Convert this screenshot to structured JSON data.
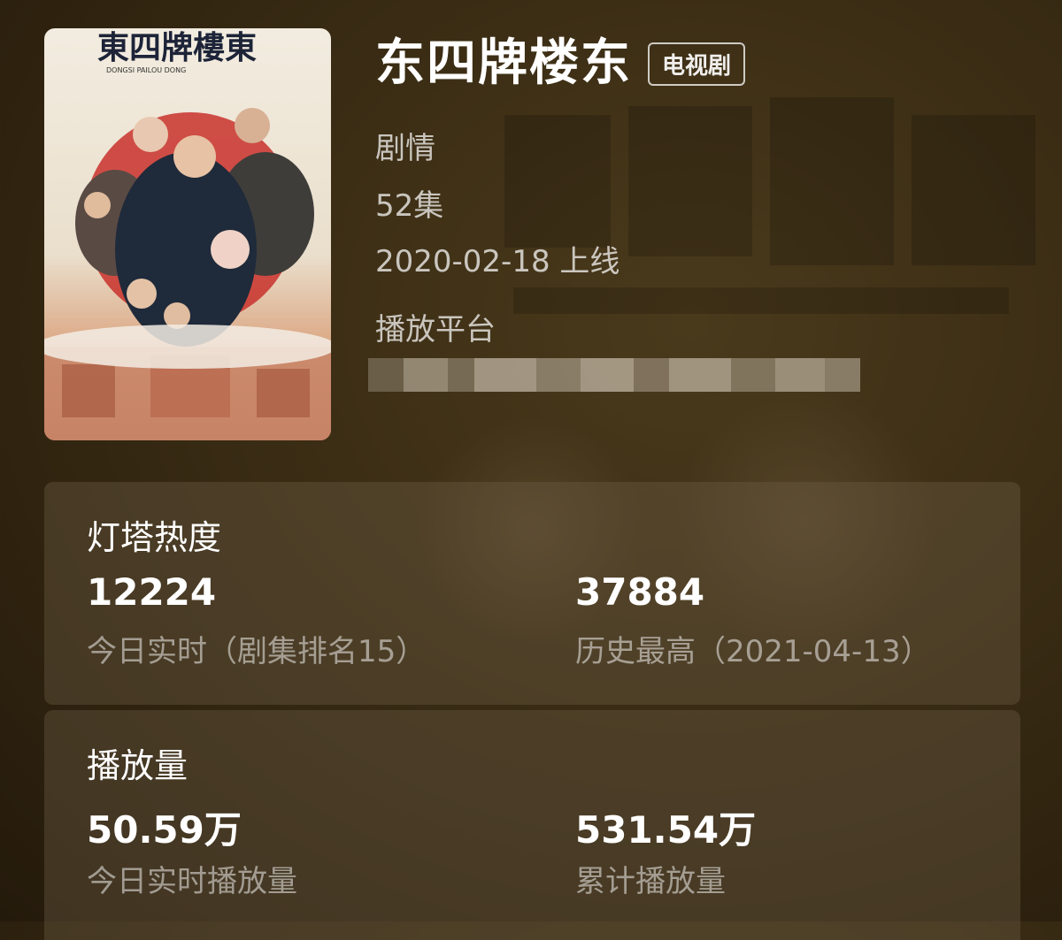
{
  "show": {
    "title": "东四牌楼东",
    "type_badge": "电视剧",
    "genre": "剧情",
    "episodes": "52集",
    "release": "2020-02-18 上线",
    "platform_label": "播放平台"
  },
  "poster": {
    "title_text": "東四牌樓東",
    "subtitle_text": "DONGSI PAILOU DONG"
  },
  "heat": {
    "title": "灯塔热度",
    "today_value": "12224",
    "today_label": "今日实时（剧集排名15）",
    "peak_value": "37884",
    "peak_label": "历史最高（2021-04-13）"
  },
  "plays": {
    "title": "播放量",
    "today_value": "50.59万",
    "today_label": "今日实时播放量",
    "total_value": "531.54万",
    "total_label": "累计播放量"
  }
}
